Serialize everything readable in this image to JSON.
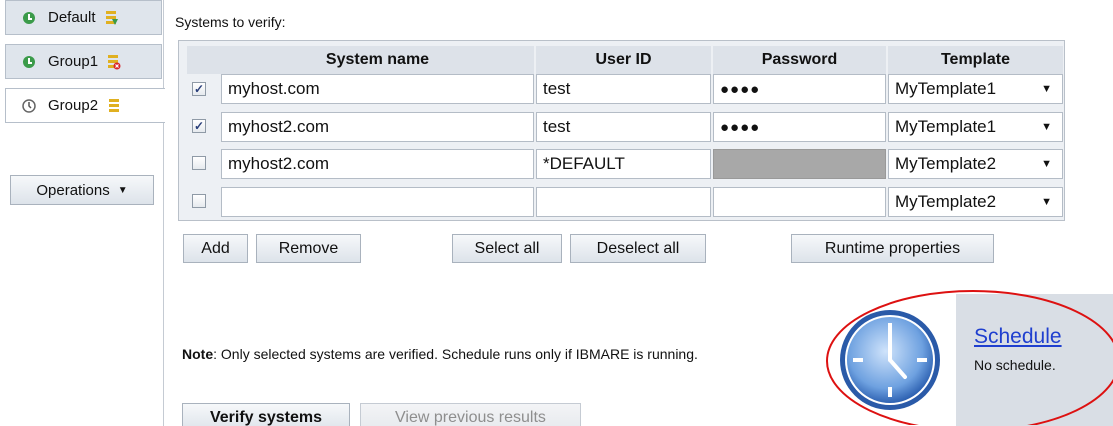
{
  "sidebar": {
    "groups": [
      {
        "label": "Default",
        "icon": "green-arrow-icon",
        "status_icon": "green-stack-icon",
        "active": false
      },
      {
        "label": "Group1",
        "icon": "green-arrow-icon",
        "status_icon": "error-stack-icon",
        "active": false
      },
      {
        "label": "Group2",
        "icon": "clock-small-icon",
        "status_icon": "stack-icon",
        "active": true
      }
    ],
    "operations_label": "Operations"
  },
  "main": {
    "section_title": "Systems to verify:",
    "table": {
      "columns": [
        "System name",
        "User ID",
        "Password",
        "Template"
      ],
      "rows": [
        {
          "checked": true,
          "system": "myhost.com",
          "user": "test",
          "password": "●●●●",
          "password_disabled": false,
          "template": "MyTemplate1"
        },
        {
          "checked": true,
          "system": "myhost2.com",
          "user": "test",
          "password": "●●●●",
          "password_disabled": false,
          "template": "MyTemplate1"
        },
        {
          "checked": false,
          "system": "myhost2.com",
          "user": "*DEFAULT",
          "password": "",
          "password_disabled": true,
          "template": "MyTemplate2"
        },
        {
          "checked": false,
          "system": "",
          "user": "",
          "password": "",
          "password_disabled": false,
          "template": "MyTemplate2"
        }
      ]
    },
    "buttons": {
      "add": "Add",
      "remove": "Remove",
      "select_all": "Select all",
      "deselect_all": "Deselect all",
      "runtime_properties": "Runtime properties",
      "verify": "Verify systems",
      "view_results": "View previous results"
    },
    "note_bold": "Note",
    "note_text": ": Only selected systems are verified. Schedule runs only if IBMARE is running."
  },
  "schedule": {
    "link_label": "Schedule",
    "status": "No schedule."
  },
  "colors": {
    "link": "#1f3fcf",
    "highlight": "#dd1111",
    "panel_bg": "#d9dee5"
  }
}
